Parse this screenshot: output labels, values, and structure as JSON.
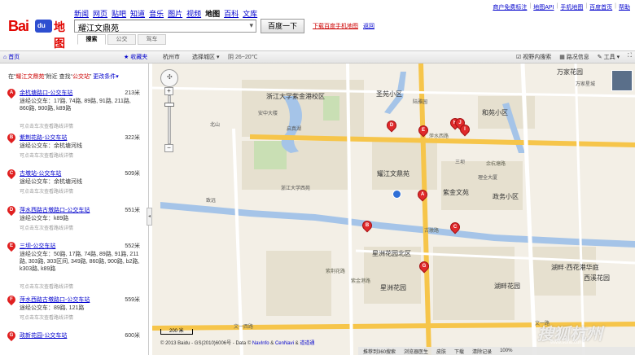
{
  "header": {
    "logo_bai": "Bai",
    "logo_du": "du",
    "logo_ditu": "地图",
    "nav": [
      "新闻",
      "网页",
      "贴吧",
      "知道",
      "音乐",
      "图片",
      "视频",
      "地图",
      "百科",
      "文库"
    ],
    "nav_current": "地图",
    "search_value": "耀江文鼎苑",
    "search_button": "百度一下",
    "download_link": "下载百度手机地图",
    "tip_link": "返回",
    "subtabs": [
      "搜索",
      "公交",
      "驾车"
    ],
    "top_links": [
      "商户免费标注",
      "地图API",
      "手机地图",
      "百度首页",
      "帮助"
    ]
  },
  "toolbar": {
    "home": "首页",
    "favorites": "收藏夹",
    "city": "杭州市",
    "area_select": "选择城区",
    "weather": "阴 26~20℃",
    "right": [
      "视野内搜索",
      "路况信息",
      "工具",
      "全屏"
    ]
  },
  "results": {
    "head_prefix": "在“",
    "head_kw1": "耀江文鼎苑",
    "head_mid": "”附近 查找“",
    "head_kw2": "公交站",
    "head_suffix": "”",
    "head_more": "更改条件",
    "hint": "可点击车次查看路线详情",
    "items": [
      {
        "letter": "A",
        "name": "余杭塘路口-公交车站",
        "dist": "213米",
        "routes": "途经公交车：17路, 74路, 89路, 91路, 211路, 860路, 900路, k89路"
      },
      {
        "letter": "B",
        "name": "紫荆花路-公交车站",
        "dist": "322米",
        "routes": "途经公交车：余杭塘河线"
      },
      {
        "letter": "C",
        "name": "古墩站-公交车站",
        "dist": "509米",
        "routes": "途经公交车：余杭塘河线"
      },
      {
        "letter": "D",
        "name": "萍水西路古墩路口-公交车站",
        "dist": "551米",
        "routes": "途经公交车：k89路"
      },
      {
        "letter": "E",
        "name": "三坝-公交车站",
        "dist": "552米",
        "routes": "途经公交车：50路, 17路, 74路, 89路, 91路, 211路, 303路, 303区间, 349路, 860路, 900路, b2路, k303路, k89路"
      },
      {
        "letter": "F",
        "name": "萍水西路古墩路口-公交车站",
        "dist": "559米",
        "routes": "途经公交车：89路, 121路"
      },
      {
        "letter": "G",
        "name": "政新花园-公交车站",
        "dist": "600米",
        "routes": ""
      }
    ]
  },
  "map": {
    "labels": {
      "zju": "浙江大学紫金港校区",
      "anzhong": "安中大楼",
      "qizhen": "启真湖",
      "sheng": "圣苑小区",
      "yuehai": "陆雅园",
      "hehe": "和苑小区",
      "wanjia": "万家花园",
      "wanjia2": "万家星城",
      "pingshui": "萍水西路",
      "yaojiang": "耀江文鼎苑",
      "zijin": "紫金文苑",
      "zhengfu": "政务小区",
      "xingyuan": "星洲花园北区",
      "xingyuan2": "星洲花园",
      "huxuan": "湖畔·西花港华庭",
      "huxuan2": "湖畔花园",
      "xixi": "西溪花园",
      "wenyi": "文一西路",
      "wenyi2": "文一路",
      "gudun": "古墩路",
      "zijinggang": "紫金港路",
      "sanba": "三坝",
      "yuhang": "余杭塘路",
      "ziyu": "紫荆花路",
      "liqian": "理全大厦",
      "daxue": "浙江大学西苑",
      "zhiji": "致远",
      "north": "北山"
    },
    "pins": [
      "D",
      "E",
      "H",
      "J",
      "I",
      "A",
      "B",
      "C",
      "G"
    ],
    "scale": "200 米",
    "copyright": "© 2013 Baidu - GS(2010)6006号 - Data ©",
    "copyright_links": [
      "NavInfo",
      "CenNavi",
      "道道通"
    ]
  },
  "statusbar": [
    "推荐到360搜索",
    "浏览器医生",
    "皮肤",
    "下载",
    "清除记录",
    "100%"
  ],
  "watermark": "搜狐杭州",
  "watermark_url": "www.sohu.com"
}
